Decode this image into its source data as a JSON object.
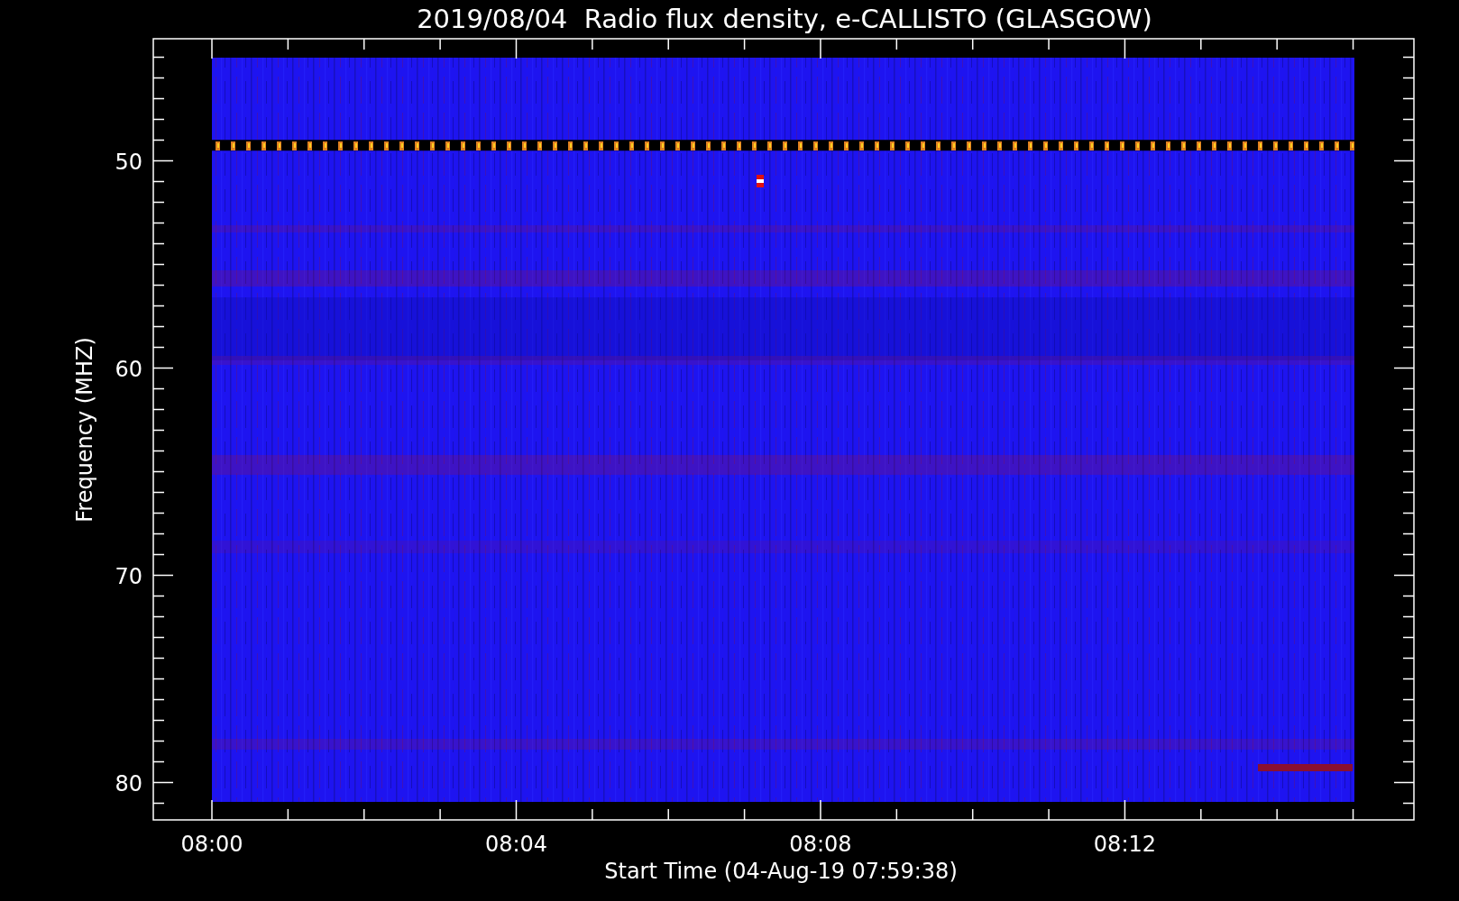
{
  "title": "2019/08/04  Radio flux density, e-CALLISTO (GLASGOW)",
  "y_axis": {
    "label": "Frequency (MHZ)",
    "ticks": [
      "50",
      "60",
      "70",
      "80"
    ]
  },
  "x_axis": {
    "label": "Start Time (04-Aug-19 07:59:38)",
    "ticks": [
      "08:00",
      "08:04",
      "08:08",
      "08:12"
    ]
  }
}
